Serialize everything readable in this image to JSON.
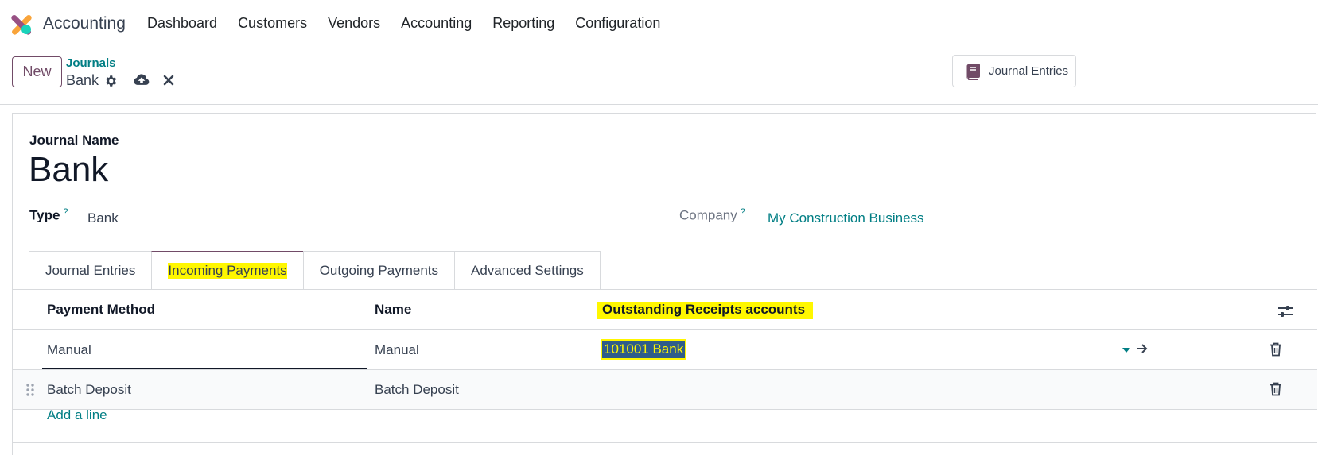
{
  "navbar": {
    "app_name": "Accounting",
    "menu": [
      "Dashboard",
      "Customers",
      "Vendors",
      "Accounting",
      "Reporting",
      "Configuration"
    ]
  },
  "control": {
    "new_label": "New",
    "breadcrumb_parent": "Journals",
    "breadcrumb_current": "Bank",
    "journal_entries_button": "Journal Entries"
  },
  "form": {
    "journal_name_label": "Journal Name",
    "journal_name": "Bank",
    "type_label": "Type",
    "type_help": "?",
    "type_value": "Bank",
    "company_label": "Company",
    "company_help": "?",
    "company_value": "My Construction Business"
  },
  "tabs": [
    "Journal Entries",
    "Incoming Payments",
    "Outgoing Payments",
    "Advanced Settings"
  ],
  "table": {
    "headers": [
      "Payment Method",
      "Name",
      "Outstanding Receipts accounts"
    ],
    "rows": [
      {
        "method": "Manual",
        "name": "Manual",
        "account": "101001 Bank"
      },
      {
        "method": "Batch Deposit",
        "name": "Batch Deposit",
        "account": ""
      }
    ],
    "add_line": "Add a line"
  },
  "colors": {
    "brand": "#714b67",
    "link": "#017e84",
    "highlight": "#fff700"
  }
}
